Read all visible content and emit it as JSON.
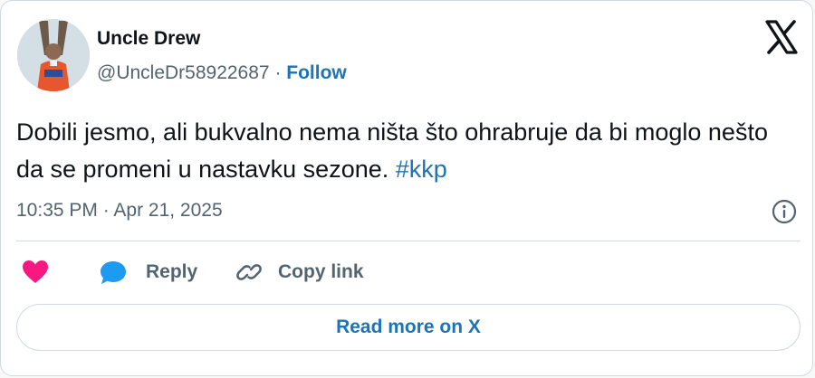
{
  "author": {
    "name": "Uncle Drew",
    "handle": "@UncleDr58922687",
    "separator": " · ",
    "follow_label": "Follow"
  },
  "tweet": {
    "text": "Dobili jesmo, ali bukvalno nema ništa što ohrabruje da bi moglo nešto da se promeni u nastavku sezone. ",
    "hashtag": "#kkp",
    "timestamp": "10:35 PM · Apr 21, 2025"
  },
  "actions": {
    "reply_label": "Reply",
    "copy_link_label": "Copy link"
  },
  "read_more_label": "Read more on X",
  "icons": {
    "brand": "x-logo-icon",
    "info": "info-icon",
    "like": "heart-icon",
    "reply": "speech-bubble-icon",
    "copy": "link-icon"
  },
  "colors": {
    "accent": "#1d73b8",
    "like": "#f91880",
    "reply": "#1d9bf0",
    "muted": "#536471",
    "text": "#0f1419",
    "border": "#cfd9de"
  }
}
